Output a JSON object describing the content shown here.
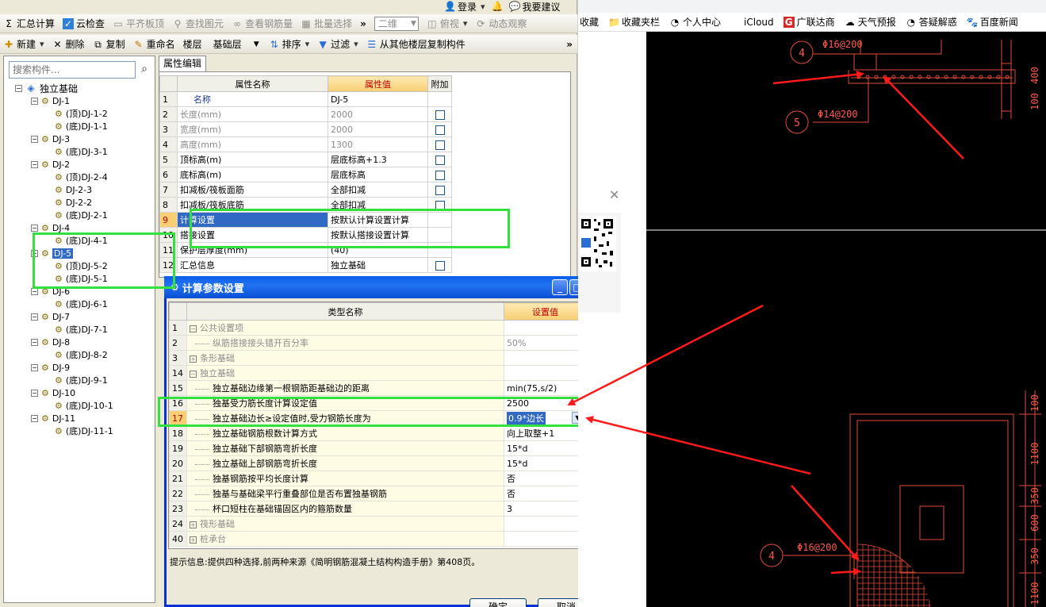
{
  "topbar": {
    "login": "登录",
    "suggest": "我要建议"
  },
  "toolbar1": {
    "summary": "汇总计算",
    "cloud_check": "云检查",
    "flush_top": "平齐板顶",
    "find_element": "查找图元",
    "view_rebar": "查看钢筋量",
    "batch_select": "批量选择",
    "view_mode": "二维",
    "ortho": "俯视",
    "dynamic": "动态观察"
  },
  "toolbar2": {
    "new": "新建",
    "delete": "删除",
    "copy": "复制",
    "rename": "重命名",
    "floor_label": "楼层",
    "floor_value": "基础层",
    "sort": "排序",
    "filter": "过滤",
    "copy_from_floor": "从其他楼层复制构件"
  },
  "search": {
    "placeholder": "搜索构件..."
  },
  "tree": {
    "root": "独立基础",
    "nodes": [
      {
        "label": "DJ-1",
        "level": 1
      },
      {
        "label": "(顶)DJ-1-2",
        "level": 2
      },
      {
        "label": "(底)DJ-1-1",
        "level": 2
      },
      {
        "label": "DJ-3",
        "level": 1
      },
      {
        "label": "(底)DJ-3-1",
        "level": 2
      },
      {
        "label": "DJ-2",
        "level": 1
      },
      {
        "label": "(顶)DJ-2-4",
        "level": 2
      },
      {
        "label": "DJ-2-3",
        "level": 2
      },
      {
        "label": "DJ-2-2",
        "level": 2
      },
      {
        "label": "(底)DJ-2-1",
        "level": 2
      },
      {
        "label": "DJ-4",
        "level": 1
      },
      {
        "label": "(底)DJ-4-1",
        "level": 2
      },
      {
        "label": "DJ-5",
        "level": 1,
        "selected": true
      },
      {
        "label": "(顶)DJ-5-2",
        "level": 2
      },
      {
        "label": "(底)DJ-5-1",
        "level": 2
      },
      {
        "label": "DJ-6",
        "level": 1
      },
      {
        "label": "(底)DJ-6-1",
        "level": 2
      },
      {
        "label": "DJ-7",
        "level": 1
      },
      {
        "label": "(底)DJ-7-1",
        "level": 2
      },
      {
        "label": "DJ-8",
        "level": 1
      },
      {
        "label": "(底)DJ-8-2",
        "level": 2
      },
      {
        "label": "DJ-9",
        "level": 1
      },
      {
        "label": "(底)DJ-9-1",
        "level": 2
      },
      {
        "label": "DJ-10",
        "level": 1
      },
      {
        "label": "(底)DJ-10-1",
        "level": 2
      },
      {
        "label": "DJ-11",
        "level": 1
      },
      {
        "label": "(底)DJ-11-1",
        "level": 2
      }
    ]
  },
  "prop_panel": {
    "tab": "属性编辑",
    "headers": {
      "name": "属性名称",
      "value": "属性值",
      "extra": "附加"
    },
    "rows": [
      {
        "num": "1",
        "name": "名称",
        "value": "DJ-5",
        "check": false,
        "gray": false,
        "link": true
      },
      {
        "num": "2",
        "name": "长度(mm)",
        "value": "2000",
        "check": true,
        "gray": true
      },
      {
        "num": "3",
        "name": "宽度(mm)",
        "value": "2000",
        "check": true,
        "gray": true
      },
      {
        "num": "4",
        "name": "高度(mm)",
        "value": "1300",
        "check": true,
        "gray": true
      },
      {
        "num": "5",
        "name": "顶标高(m)",
        "value": "层底标高+1.3",
        "check": true
      },
      {
        "num": "6",
        "name": "底标高(m)",
        "value": "层底标高",
        "check": true
      },
      {
        "num": "7",
        "name": "扣减板/筏板面筋",
        "value": "全部扣减",
        "check": true
      },
      {
        "num": "8",
        "name": "扣减板/筏板底筋",
        "value": "全部扣减",
        "check": true
      },
      {
        "num": "9",
        "name": "计算设置",
        "value": "按默认计算设置计算",
        "check": false,
        "selected": true
      },
      {
        "num": "10",
        "name": "搭接设置",
        "value": "按默认搭接设置计算",
        "check": false
      },
      {
        "num": "11",
        "name": "保护层厚度(mm)",
        "value": "(40)",
        "check": false
      },
      {
        "num": "12",
        "name": "汇总信息",
        "value": "独立基础",
        "check": true
      }
    ]
  },
  "dialog": {
    "title": "计算参数设置",
    "headers": {
      "name": "类型名称",
      "value": "设置值"
    },
    "rows": [
      {
        "num": "1",
        "name": "公共设置项",
        "value": "",
        "group": "minus"
      },
      {
        "num": "2",
        "name": "纵筋搭接接头错开百分率",
        "value": "50%",
        "child": true,
        "gray": true
      },
      {
        "num": "3",
        "name": "条形基础",
        "value": "",
        "group": "plus"
      },
      {
        "num": "14",
        "name": "独立基础",
        "value": "",
        "group": "minus"
      },
      {
        "num": "15",
        "name": "独立基础边缘第一根钢筋距基础边的距离",
        "value": "min(75,s/2)",
        "child": true
      },
      {
        "num": "16",
        "name": "独基受力筋长度计算设定值",
        "value": "2500",
        "child": true
      },
      {
        "num": "17",
        "name": "独立基础边长≥设定值时,受力钢筋长度为",
        "value": "0.9*边长",
        "child": true,
        "selected": true
      },
      {
        "num": "18",
        "name": "独立基础钢筋根数计算方式",
        "value": "向上取整+1",
        "child": true
      },
      {
        "num": "19",
        "name": "独立基础下部钢筋弯折长度",
        "value": "15*d",
        "child": true
      },
      {
        "num": "20",
        "name": "独立基础上部钢筋弯折长度",
        "value": "15*d",
        "child": true
      },
      {
        "num": "21",
        "name": "独基钢筋按平均长度计算",
        "value": "否",
        "child": true
      },
      {
        "num": "22",
        "name": "独基与基础梁平行重叠部位是否布置独基钢筋",
        "value": "否",
        "child": true
      },
      {
        "num": "23",
        "name": "杯口短柱在基础锚固区内的箍筋数量",
        "value": "3",
        "child": true
      },
      {
        "num": "24",
        "name": "筏形基础",
        "value": "",
        "group": "plus"
      },
      {
        "num": "40",
        "name": "桩承台",
        "value": "",
        "group": "plus"
      }
    ],
    "hint": "提示信息:提供四种选择,前两种来源《简明钢筋混凝土结构构造手册》第408页。",
    "ok": "确定",
    "cancel": "取消"
  },
  "browser": {
    "bookmarks": [
      "收藏",
      "收藏夹栏",
      "个人中心",
      "iCloud",
      "广联达商",
      "天气预报",
      "答疑解惑",
      "百度新闻"
    ]
  },
  "cad": {
    "rebar_top": "Φ16@200",
    "rebar_mid": "Φ14@200",
    "rebar_bottom": "Φ16@200",
    "marker_a": "4",
    "marker_b": "5",
    "marker_c": "4",
    "dims_top": [
      "400",
      "100"
    ],
    "dims_bottom": [
      "100",
      "1100",
      "350",
      "600",
      "350",
      "1100"
    ]
  },
  "colors": {
    "highlight": "#33e040",
    "arrow": "#ff1a1a",
    "cad_line": "#e04a3a",
    "cad_text": "#ff5a4a",
    "selection": "#316ac5"
  }
}
